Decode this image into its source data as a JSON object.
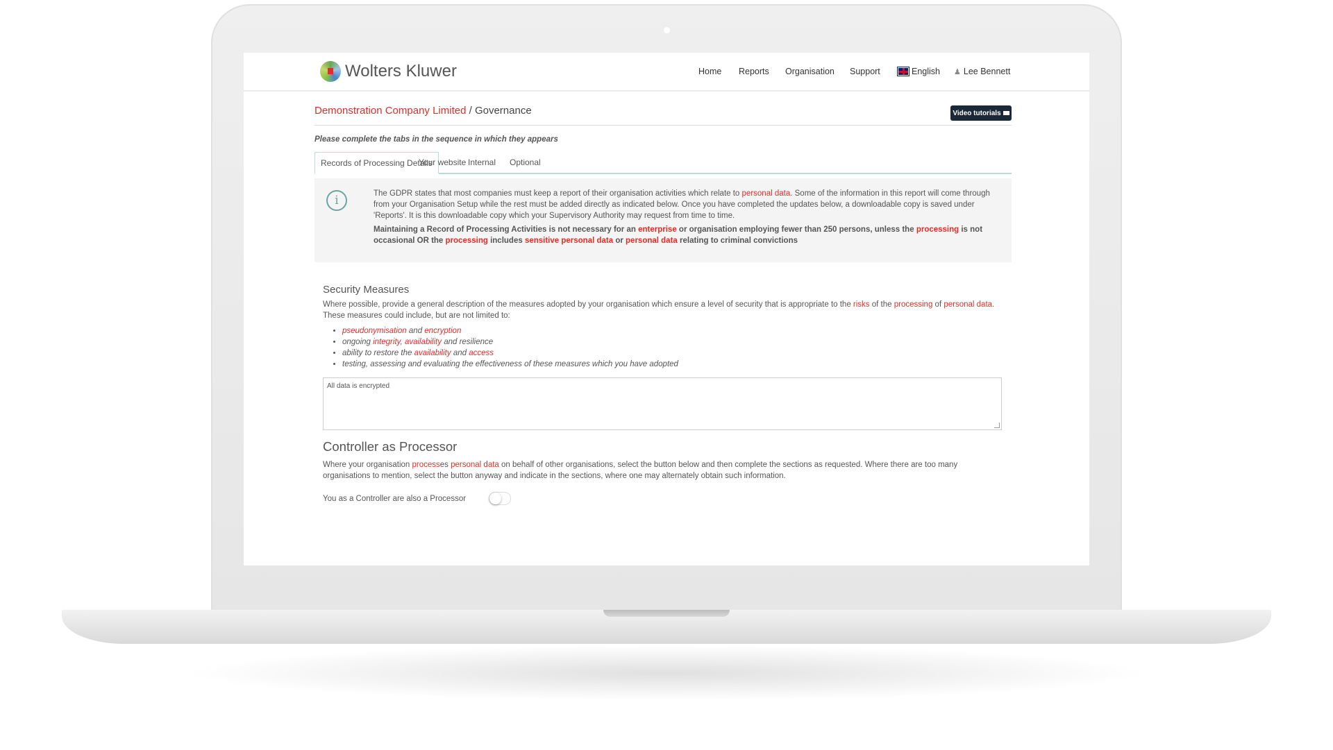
{
  "header": {
    "logo_text": "Wolters Kluwer",
    "nav": [
      "Home",
      "Reports",
      "Organisation",
      "Support"
    ],
    "language": "English",
    "user": "Lee Bennett"
  },
  "breadcrumb": {
    "company": "Demonstration Company Limited",
    "separator": " / ",
    "page": "Governance"
  },
  "video_button": "Video tutorials",
  "instructions": "Please complete the tabs in the sequence in which they appears",
  "tabs": [
    {
      "label": "Records of Processing Details",
      "active": true
    },
    {
      "label": "Your website",
      "active": false
    },
    {
      "label": "Internal",
      "active": false
    },
    {
      "label": "Optional",
      "active": false
    }
  ],
  "info": {
    "p1": [
      "The GDPR states that most companies must keep a report of their organisation activities which relate to ",
      "personal data",
      ". Some of the information in this report will come through from your Organisation Setup while the rest must be added directly as indicated below. Once you have completed the updates below, a downloadable copy is saved under 'Reports'. It is this downloadable copy which your Supervisory Authority may request from time to time."
    ],
    "p2": [
      "Maintaining a Record of Processing Activities is not necessary for an ",
      "enterprise",
      " or organisation employing fewer than 250 persons, unless the ",
      "processing",
      " is not occasional OR the ",
      "processing",
      " includes ",
      "sensitive personal data",
      " or ",
      "personal data",
      " relating to criminal convictions"
    ]
  },
  "security": {
    "title": "Security Measures",
    "desc": [
      "Where possible, provide a general description of the measures adopted by your organisation which ensure a level of security that is appropriate to the ",
      "risks",
      " of the ",
      "processing",
      " of ",
      "personal data",
      ". These measures could include, but are not limited to:"
    ],
    "bullets": [
      [
        "",
        "pseudonymisation",
        " and ",
        "encryption",
        ""
      ],
      [
        "ongoing ",
        "integrity",
        ", ",
        "availability",
        " and resilience"
      ],
      [
        "ability to restore the ",
        "availability",
        " and ",
        "access",
        ""
      ],
      [
        "testing, assessing and evaluating the effectiveness of these measures which you have adopted",
        "",
        "",
        "",
        ""
      ]
    ],
    "textarea_value": "All data is encrypted"
  },
  "controller": {
    "title": "Controller as Processor",
    "desc": [
      "Where your organisation ",
      "process",
      "es ",
      "personal data",
      " on behalf of other organisations, select the button below and then complete the sections as requested. Where there are too many organisations to mention, select the button anyway and indicate in the sections, where one may alternately obtain such information."
    ],
    "toggle_label": "You as a Controller are also a Processor",
    "toggle_on": false
  },
  "colors": {
    "accent_red": "#d8312a",
    "tab_border": "#b9dcda",
    "button_dark": "#1b2838"
  }
}
